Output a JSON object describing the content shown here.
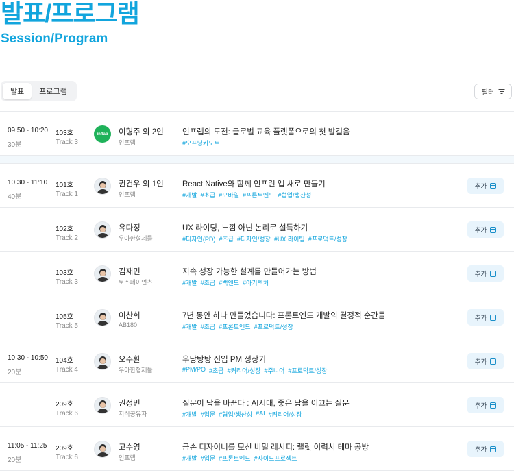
{
  "header": {
    "title_ko": "발표/프로그램",
    "title_en": "Session/Program"
  },
  "tabs": [
    {
      "label": "발표",
      "active": true
    },
    {
      "label": "프로그램",
      "active": false
    }
  ],
  "filter": {
    "label": "필터",
    "icon": "filter-icon"
  },
  "add_label": "추가",
  "sessions": [
    {
      "time": "09:50 - 10:20",
      "duration": "30분",
      "room": "103호",
      "track": "Track 3",
      "speaker": "이형주 외 2인",
      "org": "인프랩",
      "avatar": "logo",
      "logo_text": "inflab",
      "title": "인프랩의 도전: 글로벌 교육 플랫폼으로의 첫 발걸음",
      "tags": [
        "#오프닝키노트"
      ],
      "has_add": false
    },
    {
      "time": "10:30 - 11:10",
      "duration": "40분",
      "room": "101호",
      "track": "Track 1",
      "speaker": "권건우 외 1인",
      "org": "인프랩",
      "avatar": "person",
      "title": "React Native와 함께 인프런 앱 새로 만들기",
      "tags": [
        "#개발",
        "#초급",
        "#모바일",
        "#프론트엔드",
        "#협업/생산성"
      ],
      "has_add": true
    },
    {
      "time": "",
      "duration": "",
      "room": "102호",
      "track": "Track 2",
      "speaker": "유다정",
      "org": "우아한형제들",
      "avatar": "person",
      "title": "UX 라이팅, 느낌 아닌 논리로 설득하기",
      "tags": [
        "#디자인(PD)",
        "#초급",
        "#디자인/성장",
        "#UX 라이팅",
        "#프로덕트/성장"
      ],
      "has_add": true
    },
    {
      "time": "",
      "duration": "",
      "room": "103호",
      "track": "Track 3",
      "speaker": "김재민",
      "org": "토스페이먼츠",
      "avatar": "person",
      "title": "지속 성장 가능한 설계를 만들어가는 방법",
      "tags": [
        "#개발",
        "#초급",
        "#백엔드",
        "#아키텍처"
      ],
      "has_add": true
    },
    {
      "time": "",
      "duration": "",
      "room": "105호",
      "track": "Track 5",
      "speaker": "이찬희",
      "org": "AB180",
      "avatar": "person",
      "title": "7년 동안 하나 만들었습니다: 프론트엔드 개발의 결정적 순간들",
      "tags": [
        "#개발",
        "#초급",
        "#프론트엔드",
        "#프로덕트/성장"
      ],
      "has_add": true
    },
    {
      "time": "10:30 - 10:50",
      "duration": "20분",
      "room": "104호",
      "track": "Track 4",
      "speaker": "오주환",
      "org": "우아한형제들",
      "avatar": "person",
      "title": "우당탕탕 신입 PM 성장기",
      "tags": [
        "#PM/PO",
        "#초급",
        "#커리어/성장",
        "#주니어",
        "#프로덕트/성장"
      ],
      "has_add": true
    },
    {
      "time": "",
      "duration": "",
      "room": "209호",
      "track": "Track 6",
      "speaker": "권정민",
      "org": "지식공유자",
      "avatar": "person",
      "title": "질문이 답을 바꾼다 : AI시대, 좋은 답을 이끄는 질문",
      "tags": [
        "#개발",
        "#입문",
        "#협업/생산성",
        "#AI",
        "#커리어/성장"
      ],
      "has_add": true
    },
    {
      "time": "11:05 - 11:25",
      "duration": "20분",
      "room": "209호",
      "track": "Track 6",
      "speaker": "고수영",
      "org": "인프랩",
      "avatar": "person",
      "title": "금손 디자이너를 모신 비밀 레시피: 랠릿 이력서 테마 공방",
      "tags": [
        "#개발",
        "#입문",
        "#프론트엔드",
        "#사이드프로젝트"
      ],
      "has_add": true
    }
  ],
  "colors": {
    "accent": "#12a5dd",
    "tag": "#12a5dd",
    "add_bg": "#e8f4fc"
  }
}
